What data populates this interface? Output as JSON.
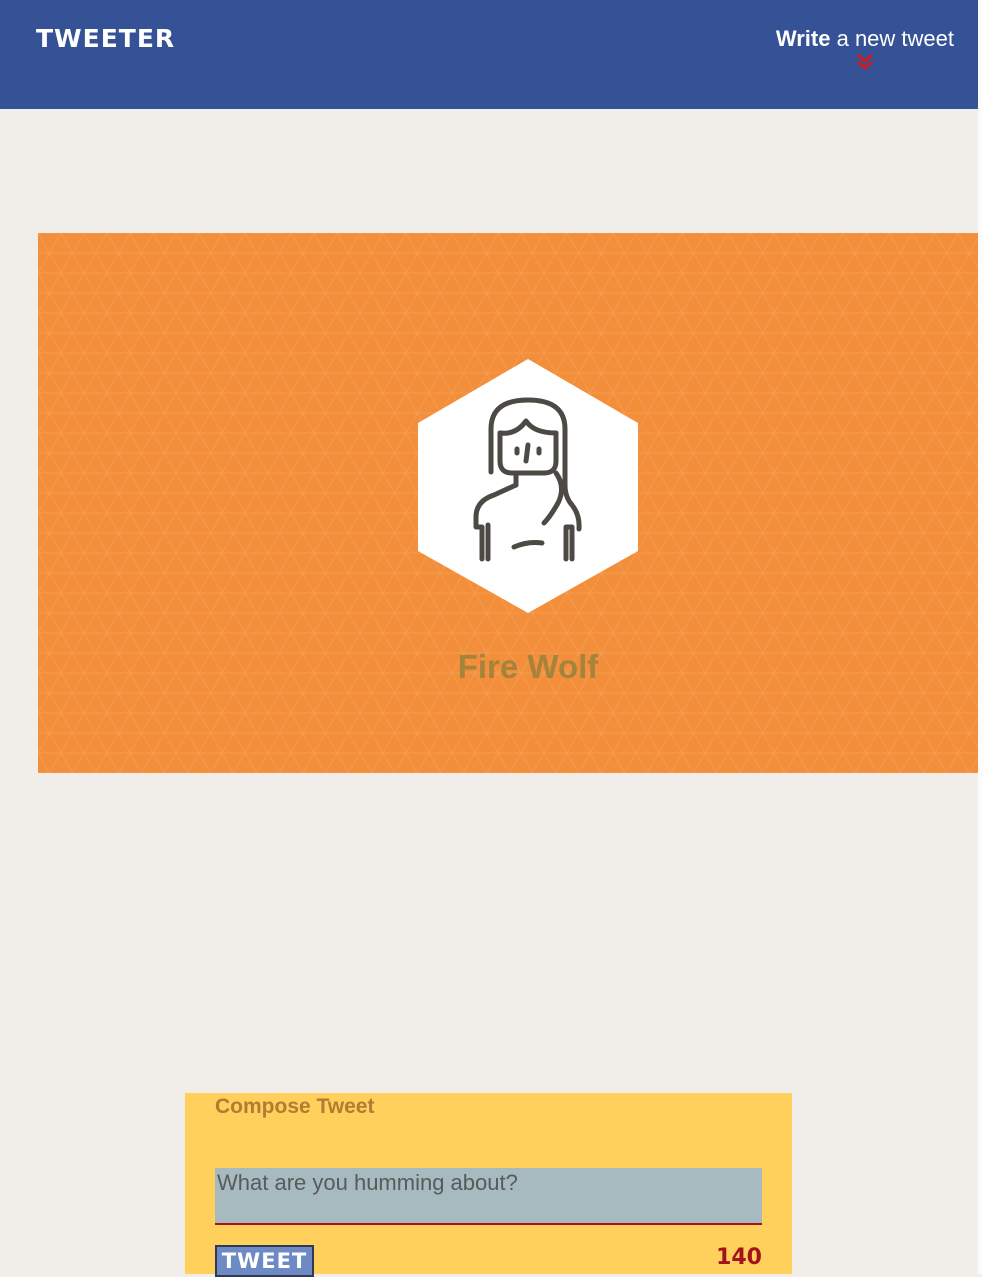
{
  "nav": {
    "logo": "TWEETER",
    "compose_toggle": {
      "strong": "Write",
      "rest": " a new tweet",
      "icon": "double-chevron-down-icon"
    }
  },
  "profile": {
    "name": "Fire Wolf",
    "avatar_icon": "woman-avatar-icon",
    "banner_color": "#f38f3b"
  },
  "compose": {
    "heading": "Compose Tweet",
    "placeholder": "What are you humming about?",
    "value": "",
    "submit_label": "TWEET",
    "char_counter": "140"
  },
  "colors": {
    "nav": "#345295",
    "page_background": "#f1eeea",
    "compose_background": "#ffd05b",
    "accent_red": "#a5121b",
    "profile_name": "#a6833a"
  }
}
